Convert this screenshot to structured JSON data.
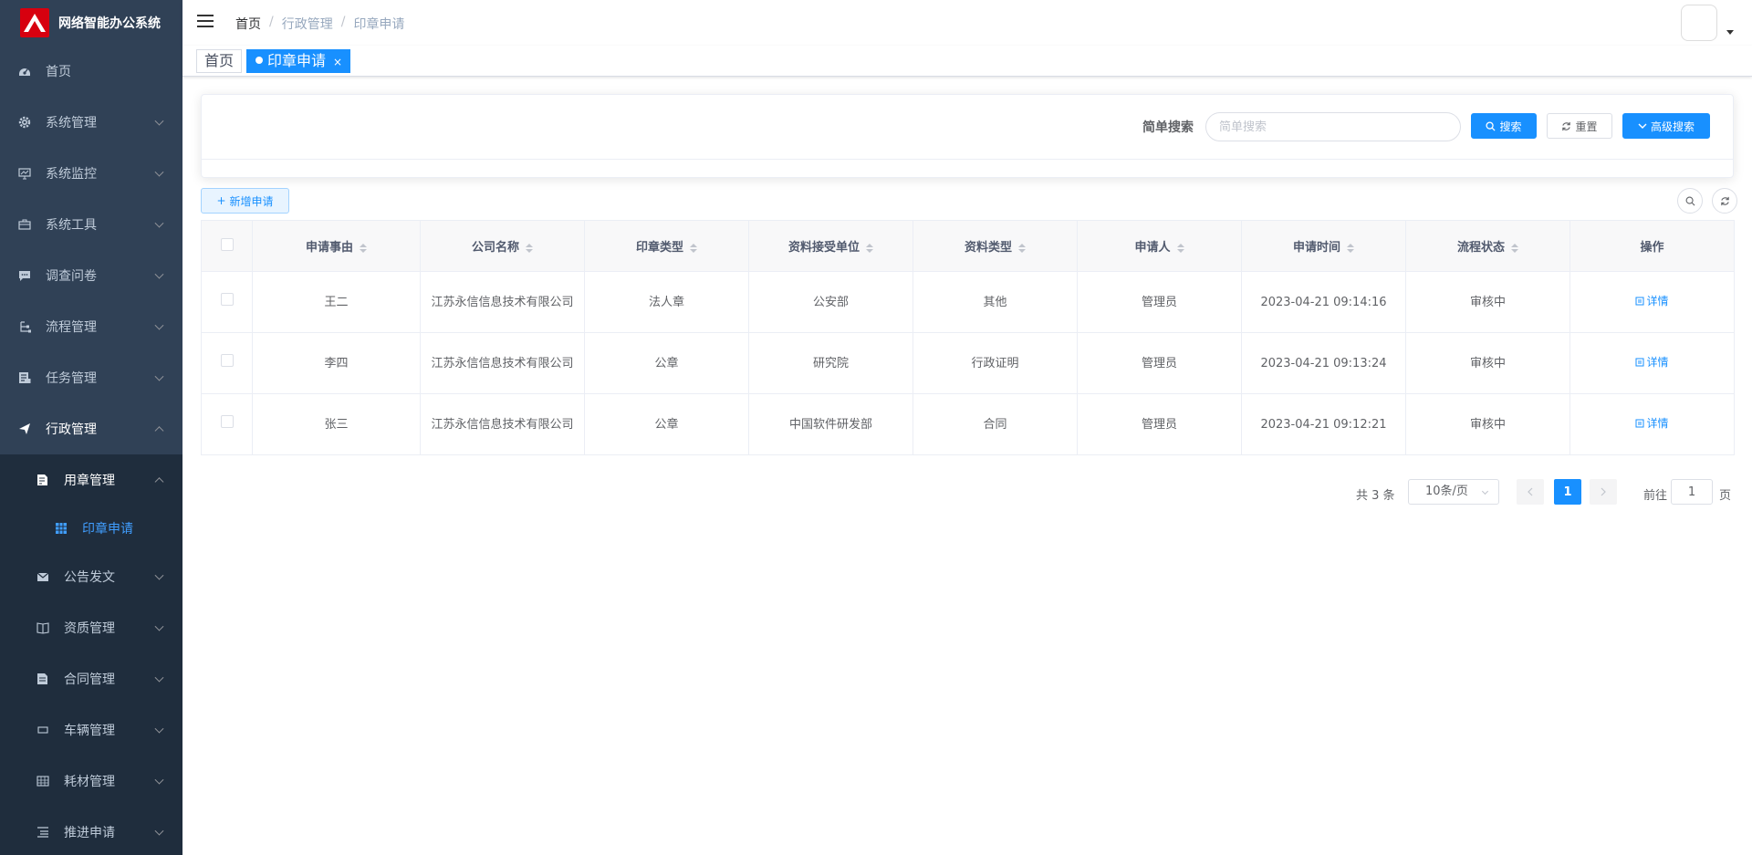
{
  "app": {
    "title": "网络智能办公系统"
  },
  "sidebar": {
    "items": [
      {
        "label": "首页",
        "icon": "dashboard-icon"
      },
      {
        "label": "系统管理",
        "icon": "gear-icon"
      },
      {
        "label": "系统监控",
        "icon": "monitor-icon"
      },
      {
        "label": "系统工具",
        "icon": "toolbox-icon"
      },
      {
        "label": "调查问卷",
        "icon": "message-icon"
      },
      {
        "label": "流程管理",
        "icon": "flow-icon"
      },
      {
        "label": "任务管理",
        "icon": "task-icon"
      },
      {
        "label": "行政管理",
        "icon": "send-icon"
      }
    ],
    "submenu": {
      "group": {
        "label": "用章管理",
        "icon": "seal-doc-icon"
      },
      "active": {
        "label": "印章申请",
        "icon": "grid-icon"
      },
      "items": [
        {
          "label": "公告发文",
          "icon": "mail-icon"
        },
        {
          "label": "资质管理",
          "icon": "book-icon"
        },
        {
          "label": "合同管理",
          "icon": "contract-icon"
        },
        {
          "label": "车辆管理",
          "icon": "car-icon"
        },
        {
          "label": "耗材管理",
          "icon": "box-icon"
        },
        {
          "label": "推进申请",
          "icon": "list-icon"
        }
      ]
    }
  },
  "breadcrumb": [
    "首页",
    "行政管理",
    "印章申请"
  ],
  "tags": {
    "home": "首页",
    "current": "印章申请",
    "close": "×"
  },
  "search": {
    "label": "简单搜索",
    "placeholder": "简单搜索",
    "search_btn": "搜索",
    "reset_btn": "重置",
    "advanced_btn": "高级搜索"
  },
  "toolbar": {
    "add_btn": "新增申请"
  },
  "table": {
    "columns": [
      "申请事由",
      "公司名称",
      "印章类型",
      "资料接受单位",
      "资料类型",
      "申请人",
      "申请时间",
      "流程状态",
      "操作"
    ],
    "rows": [
      {
        "reason": "王二",
        "company": "江苏永信信息技术有限公司",
        "seal_type": "法人章",
        "receiver": "公安部",
        "doc_type": "其他",
        "applicant": "管理员",
        "time": "2023-04-21 09:14:16",
        "status": "审核中",
        "action": "详情"
      },
      {
        "reason": "李四",
        "company": "江苏永信信息技术有限公司",
        "seal_type": "公章",
        "receiver": "研究院",
        "doc_type": "行政证明",
        "applicant": "管理员",
        "time": "2023-04-21 09:13:24",
        "status": "审核中",
        "action": "详情"
      },
      {
        "reason": "张三",
        "company": "江苏永信信息技术有限公司",
        "seal_type": "公章",
        "receiver": "中国软件研发部",
        "doc_type": "合同",
        "applicant": "管理员",
        "time": "2023-04-21 09:12:21",
        "status": "审核中",
        "action": "详情"
      }
    ]
  },
  "pagination": {
    "total": "共 3 条",
    "page_size": "10条/页",
    "current_page": "1",
    "goto_label": "前往",
    "goto_value": "1",
    "page_unit": "页"
  },
  "colors": {
    "sidebar_bg": "#304156",
    "submenu_bg": "#1f2d3d",
    "primary": "#1890ff",
    "logo": "#d7000f"
  }
}
